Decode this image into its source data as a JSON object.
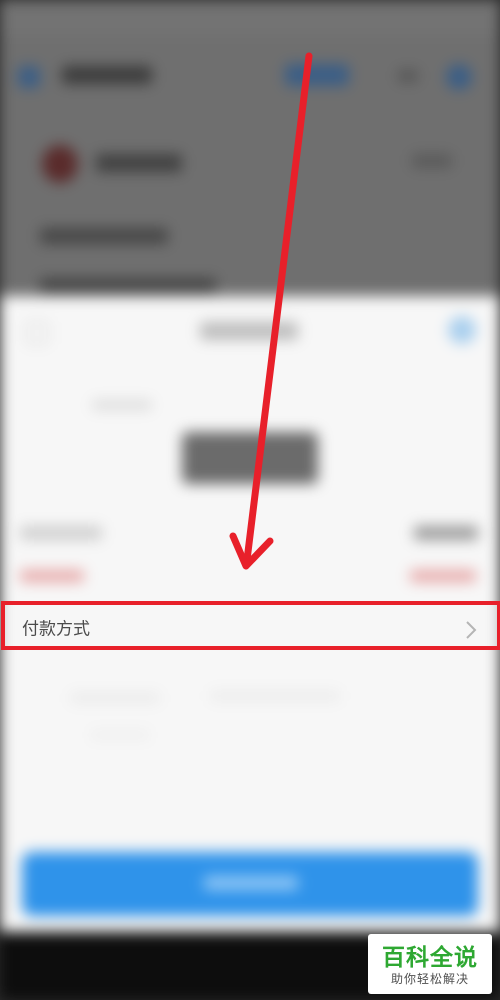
{
  "payment_method_row": {
    "label": "付款方式",
    "chevron_icon": "chevron-right-icon"
  },
  "annotation": {
    "color": "#e8202a",
    "arrow_icon": "arrow-down-icon"
  },
  "watermark": {
    "title": "百科全说",
    "subtitle": "助你轻松解决",
    "title_color": "#2ea832"
  },
  "colors": {
    "primary_button": "#2f93ea",
    "sheet_background": "#f7f7f7",
    "dim_overlay": "#6f6f6f",
    "nav_bar": "#0d0d0d"
  }
}
